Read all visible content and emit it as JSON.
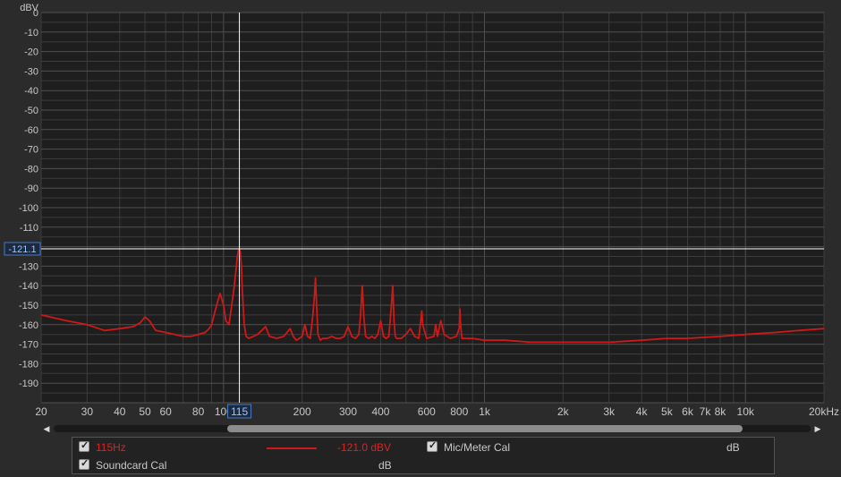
{
  "colors": {
    "background": "#2b2b2b",
    "plot_background": "#1e1e1e",
    "grid": "#3c3c3c",
    "grid_major": "#505050",
    "trace": "#d01818",
    "cursor": "#ffffff",
    "label": "#c8c8c8",
    "cursor_label_border": "#4a7ac0",
    "cursor_label_text": "#9ec2ff"
  },
  "chart_data": {
    "type": "line",
    "title": "",
    "xlabel": "",
    "ylabel": "dBV",
    "x_scale": "log",
    "xlim": [
      20,
      20000
    ],
    "ylim": [
      -200,
      0
    ],
    "grid": true,
    "y_ticks": [
      "0",
      "-10",
      "-20",
      "-30",
      "-40",
      "-50",
      "-60",
      "-70",
      "-80",
      "-90",
      "-100",
      "-110",
      "-120",
      "-130",
      "-140",
      "-150",
      "-160",
      "-170",
      "-180",
      "-190"
    ],
    "y_tick_values": [
      0,
      -10,
      -20,
      -30,
      -40,
      -50,
      -60,
      -70,
      -80,
      -90,
      -100,
      -110,
      -120,
      -130,
      -140,
      -150,
      -160,
      -170,
      -180,
      -190
    ],
    "x_ticks": [
      "20",
      "30",
      "40",
      "50",
      "60",
      "80",
      "100",
      "200",
      "300",
      "400",
      "600",
      "800",
      "1k",
      "2k",
      "3k",
      "4k",
      "5k",
      "6k",
      "7k",
      "8k",
      "10k",
      "20kHz"
    ],
    "x_tick_values": [
      20,
      30,
      40,
      50,
      60,
      80,
      100,
      200,
      300,
      400,
      600,
      800,
      1000,
      2000,
      3000,
      4000,
      5000,
      6000,
      7000,
      8000,
      10000,
      20000
    ],
    "cursor": {
      "x": 115,
      "y": -121.1,
      "x_label": "115",
      "y_label": "-121.1"
    },
    "series": [
      {
        "name": "115Hz",
        "x": [
          20,
          25,
          30,
          35,
          40,
          45,
          48,
          50,
          52,
          55,
          60,
          65,
          70,
          75,
          80,
          85,
          88,
          90,
          92,
          95,
          97,
          100,
          102,
          105,
          107,
          110,
          112,
          113,
          114,
          115,
          116,
          117,
          118,
          120,
          122,
          125,
          130,
          135,
          140,
          145,
          150,
          160,
          170,
          180,
          185,
          190,
          195,
          200,
          205,
          210,
          215,
          220,
          223,
          225,
          227,
          230,
          235,
          240,
          250,
          260,
          270,
          280,
          290,
          300,
          310,
          320,
          330,
          335,
          340,
          345,
          350,
          360,
          370,
          380,
          390,
          400,
          410,
          420,
          430,
          440,
          445,
          450,
          455,
          460,
          480,
          500,
          520,
          540,
          560,
          570,
          575,
          580,
          600,
          640,
          650,
          660,
          680,
          700,
          740,
          780,
          800,
          805,
          810,
          820,
          900,
          1000,
          1200,
          1500,
          2000,
          2500,
          3000,
          4000,
          5000,
          6000,
          8000,
          10000,
          13000,
          16000,
          20000
        ],
        "y": [
          -155,
          -158,
          -160,
          -163,
          -162,
          -161,
          -159,
          -156,
          -158,
          -163,
          -164,
          -165,
          -166,
          -166,
          -165,
          -164,
          -162,
          -160,
          -155,
          -148,
          -144,
          -150,
          -158,
          -160,
          -152,
          -140,
          -130,
          -125,
          -122,
          -121,
          -123,
          -130,
          -142,
          -160,
          -166,
          -167,
          -166,
          -165,
          -163,
          -161,
          -166,
          -167,
          -166,
          -162,
          -166,
          -168,
          -167,
          -166,
          -160,
          -166,
          -167,
          -155,
          -145,
          -136,
          -148,
          -165,
          -168,
          -167,
          -167,
          -166,
          -167,
          -167,
          -166,
          -161,
          -166,
          -167,
          -165,
          -155,
          -140,
          -156,
          -166,
          -167,
          -166,
          -167,
          -165,
          -158,
          -166,
          -167,
          -166,
          -150,
          -140,
          -158,
          -166,
          -167,
          -167,
          -165,
          -162,
          -166,
          -167,
          -158,
          -153,
          -160,
          -167,
          -166,
          -160,
          -166,
          -158,
          -165,
          -167,
          -166,
          -162,
          -152,
          -160,
          -167,
          -167,
          -168,
          -168,
          -169,
          -169,
          -169,
          -169,
          -168,
          -167,
          -167,
          -166,
          -165,
          -164,
          -163,
          -162
        ]
      }
    ],
    "legend": [
      {
        "label": "115Hz",
        "value": "-121.0 dBV",
        "checked": true
      },
      {
        "label": "Mic/Meter Cal",
        "unit": "dB",
        "checked": true
      },
      {
        "label": "Soundcard Cal",
        "unit": "dB",
        "checked": true
      }
    ]
  },
  "legend_ui": {
    "trace_label": "115Hz",
    "trace_value": "-121.0 dBV",
    "mic_cal_label": "Mic/Meter Cal",
    "mic_cal_unit": "dB",
    "soundcard_cal_label": "Soundcard Cal",
    "soundcard_cal_unit": "dB",
    "check_glyph": "✓"
  },
  "scrollbar": {
    "left_arrow": "◀",
    "right_arrow": "▶"
  }
}
